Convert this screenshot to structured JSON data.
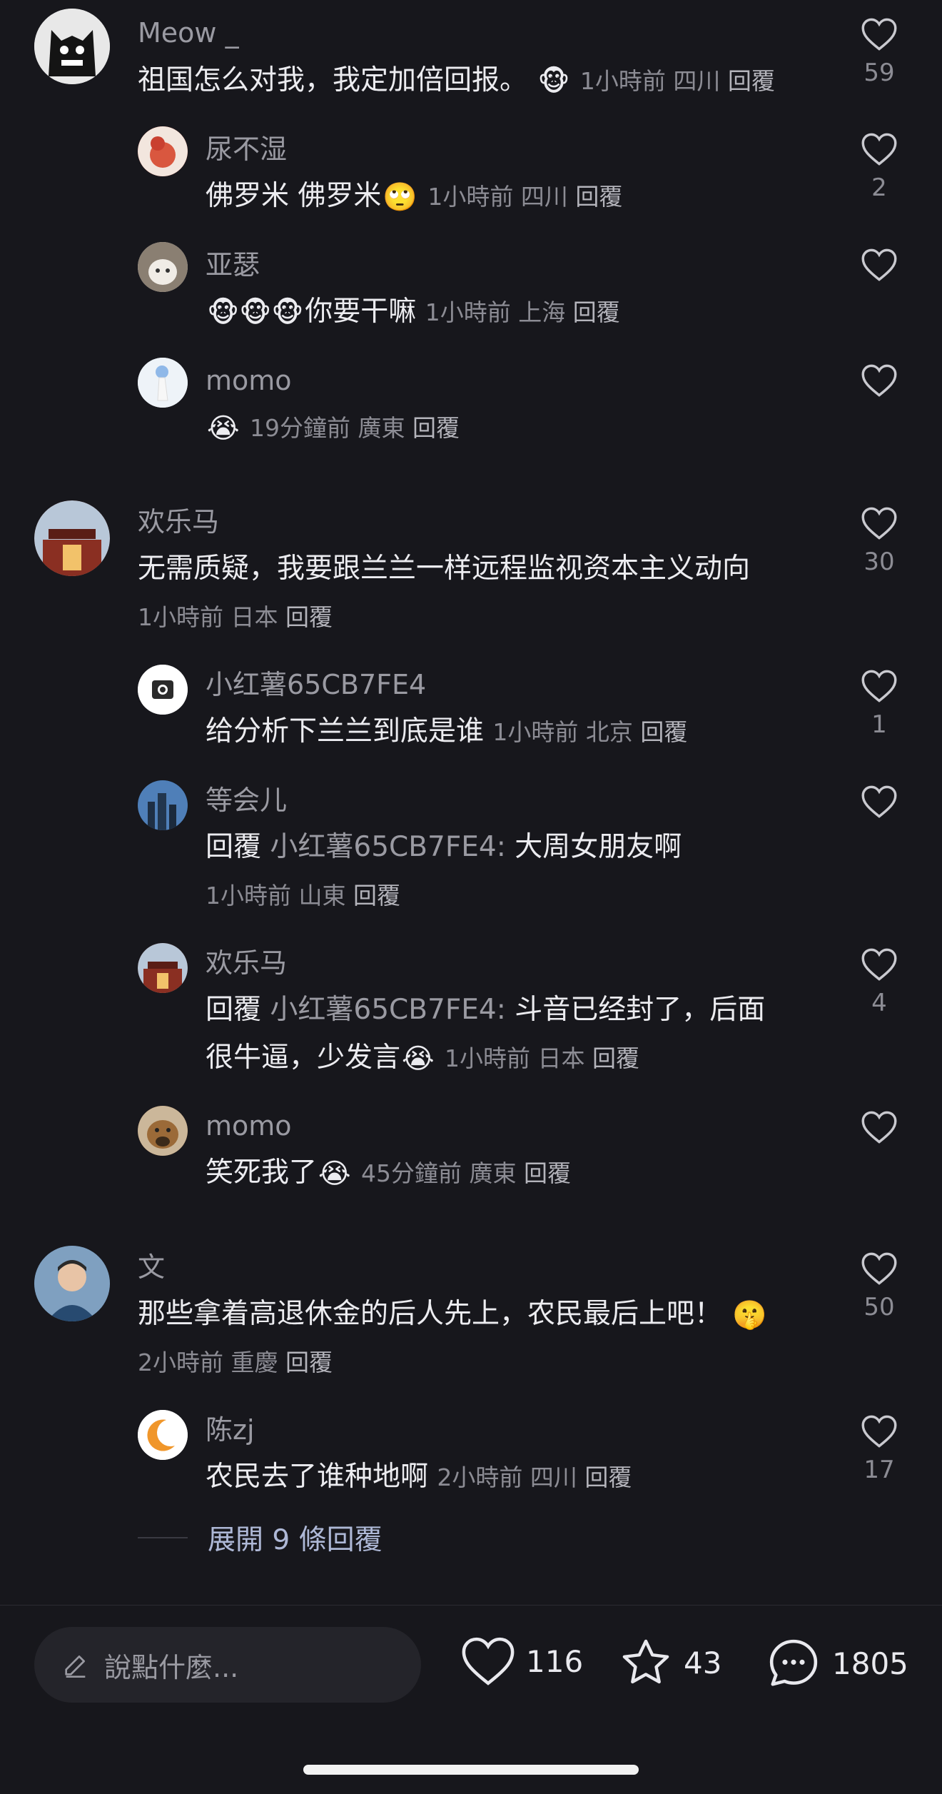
{
  "comments": [
    {
      "user": "Meow _",
      "text": "祖国怎么对我，我定加倍回报。",
      "emoji": "🐵",
      "time": "1小時前",
      "loc": "四川",
      "reply": "回覆",
      "likes": "59"
    },
    {
      "user": "尿不湿",
      "text": "佛罗米 佛罗米",
      "emoji": "🙄",
      "time": "1小時前",
      "loc": "四川",
      "reply": "回覆",
      "likes": "2"
    },
    {
      "user": "亚瑟",
      "text": "你要干嘛",
      "emoji": "🐵🐵🐵",
      "time": "1小時前",
      "loc": "上海",
      "reply": "回覆",
      "likes": ""
    },
    {
      "user": "momo",
      "text": "",
      "emoji": "😭",
      "time": "19分鐘前",
      "loc": "廣東",
      "reply": "回覆",
      "likes": ""
    },
    {
      "user": "欢乐马",
      "text": "无需质疑，我要跟兰兰一样远程监视资本主义动向",
      "time": "1小時前",
      "loc": "日本",
      "reply": "回覆",
      "likes": "30"
    },
    {
      "user": "小红薯65CB7FE4",
      "text": "给分析下兰兰到底是谁",
      "time": "1小時前",
      "loc": "北京",
      "reply": "回覆",
      "likes": "1"
    },
    {
      "user": "等会儿",
      "prefix": "回覆",
      "mention": "小红薯65CB7FE4:",
      "text": "大周女朋友啊",
      "time": "1小時前",
      "loc": "山東",
      "reply": "回覆",
      "likes": ""
    },
    {
      "user": "欢乐马",
      "prefix": "回覆",
      "mention": "小红薯65CB7FE4:",
      "text": "斗音已经封了，后面",
      "text2": "很牛逼，少发言",
      "emoji": "😭",
      "time": "1小時前",
      "loc": "日本",
      "reply": "回覆",
      "likes": "4"
    },
    {
      "user": "momo",
      "text": "笑死我了",
      "emoji": "😭",
      "time": "45分鐘前",
      "loc": "廣東",
      "reply": "回覆",
      "likes": ""
    },
    {
      "user": "文",
      "text": "那些拿着高退休金的后人先上，农民最后上吧！",
      "emoji": "🤫",
      "time": "2小時前",
      "loc": "重慶",
      "reply": "回覆",
      "likes": "50"
    },
    {
      "user": "陈zj",
      "text": "农民去了谁种地啊",
      "time": "2小時前",
      "loc": "四川",
      "reply": "回覆",
      "likes": "17"
    }
  ],
  "expand_label": "展開 9 條回覆",
  "bottom": {
    "placeholder": "說點什麼...",
    "likes": "116",
    "stars": "43",
    "comments": "1805"
  },
  "icons": {
    "like": "heart-outline-icon",
    "pen": "pencil-icon",
    "star": "star-icon",
    "chat": "chat-bubble-icon"
  },
  "colors": {
    "background": "#17171c",
    "text": "#e9e9ee",
    "muted": "#8c8c94"
  }
}
